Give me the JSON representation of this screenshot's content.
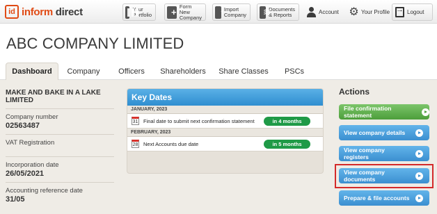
{
  "app": {
    "logo_mark": "id",
    "logo_word1": "inform",
    "logo_word2": "direct"
  },
  "topnav": {
    "portfolio": "Your\nPortfolio",
    "form_new": "Form New\nCompany",
    "import": "Import\nCompany",
    "documents": "Documents\n& Reports",
    "account": "Account",
    "profile": "Your Profile",
    "logout": "Logout"
  },
  "company": {
    "title": "ABC COMPANY LIMITED"
  },
  "tabs": [
    {
      "label": "Dashboard",
      "active": true
    },
    {
      "label": "Company"
    },
    {
      "label": "Officers"
    },
    {
      "label": "Shareholders"
    },
    {
      "label": "Share Classes"
    },
    {
      "label": "PSCs"
    }
  ],
  "details": {
    "name": "MAKE AND BAKE IN A LAKE LIMITED",
    "company_number_label": "Company number",
    "company_number": "02563487",
    "vat_label": "VAT Registration",
    "incorporation_label": "Incorporation date",
    "incorporation_date": "26/05/2021",
    "ard_label": "Accounting reference date",
    "ard": "31/05"
  },
  "key_dates": {
    "title": "Key Dates",
    "groups": [
      {
        "month": "JANUARY, 2023",
        "day": "31",
        "text": "Final date to submit next confirmation statement",
        "due": "in 4 months"
      },
      {
        "month": "FEBRUARY, 2023",
        "day": "28",
        "text": "Next Accounts due date",
        "due": "in 5 months"
      }
    ]
  },
  "actions": {
    "title": "Actions",
    "items": [
      {
        "label": "File confirmation statement",
        "color": "#4c9e3b"
      },
      {
        "label": "View company details",
        "color": "#3b8fd0"
      },
      {
        "label": "View company registers",
        "color": "#3b8fd0"
      },
      {
        "label": "View company documents",
        "color": "#3b8fd0",
        "highlighted": true
      },
      {
        "label": "Prepare & file accounts",
        "color": "#3b8fd0"
      }
    ]
  },
  "colors": {
    "brand": "#e04a14",
    "accent_blue": "#3b8fd0",
    "success_green": "#1f9a47",
    "highlight_red": "#d42a2a"
  }
}
